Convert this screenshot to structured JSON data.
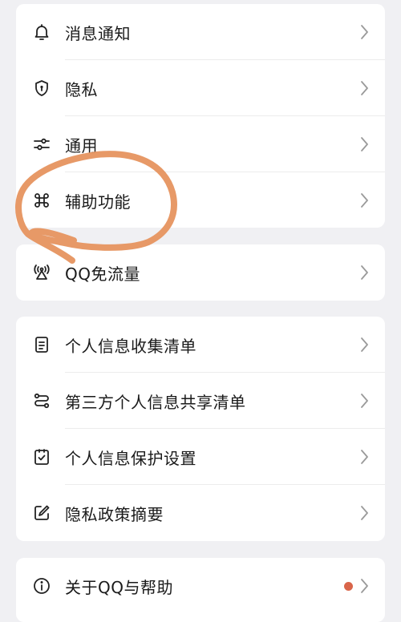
{
  "groups": [
    {
      "items": [
        {
          "label": "消息通知",
          "icon": "bell-icon"
        },
        {
          "label": "隐私",
          "icon": "shield-icon"
        },
        {
          "label": "通用",
          "icon": "sliders-icon"
        },
        {
          "label": "辅助功能",
          "icon": "command-icon"
        }
      ]
    },
    {
      "items": [
        {
          "label": "QQ免流量",
          "icon": "antenna-icon"
        }
      ]
    },
    {
      "items": [
        {
          "label": "个人信息收集清单",
          "icon": "document-icon"
        },
        {
          "label": "第三方个人信息共享清单",
          "icon": "share-flow-icon"
        },
        {
          "label": "个人信息保护设置",
          "icon": "checkbox-icon"
        },
        {
          "label": "隐私政策摘要",
          "icon": "edit-icon"
        }
      ]
    },
    {
      "items": [
        {
          "label": "关于QQ与帮助",
          "icon": "info-icon",
          "has_notification_dot": true
        }
      ]
    }
  ],
  "colors": {
    "background": "#f0f0f3",
    "card": "#ffffff",
    "text": "#1a1a1a",
    "icon": "#222222",
    "chevron": "#9a9a9a",
    "notification_dot": "#d9654a",
    "annotation_stroke": "#e6935f"
  }
}
